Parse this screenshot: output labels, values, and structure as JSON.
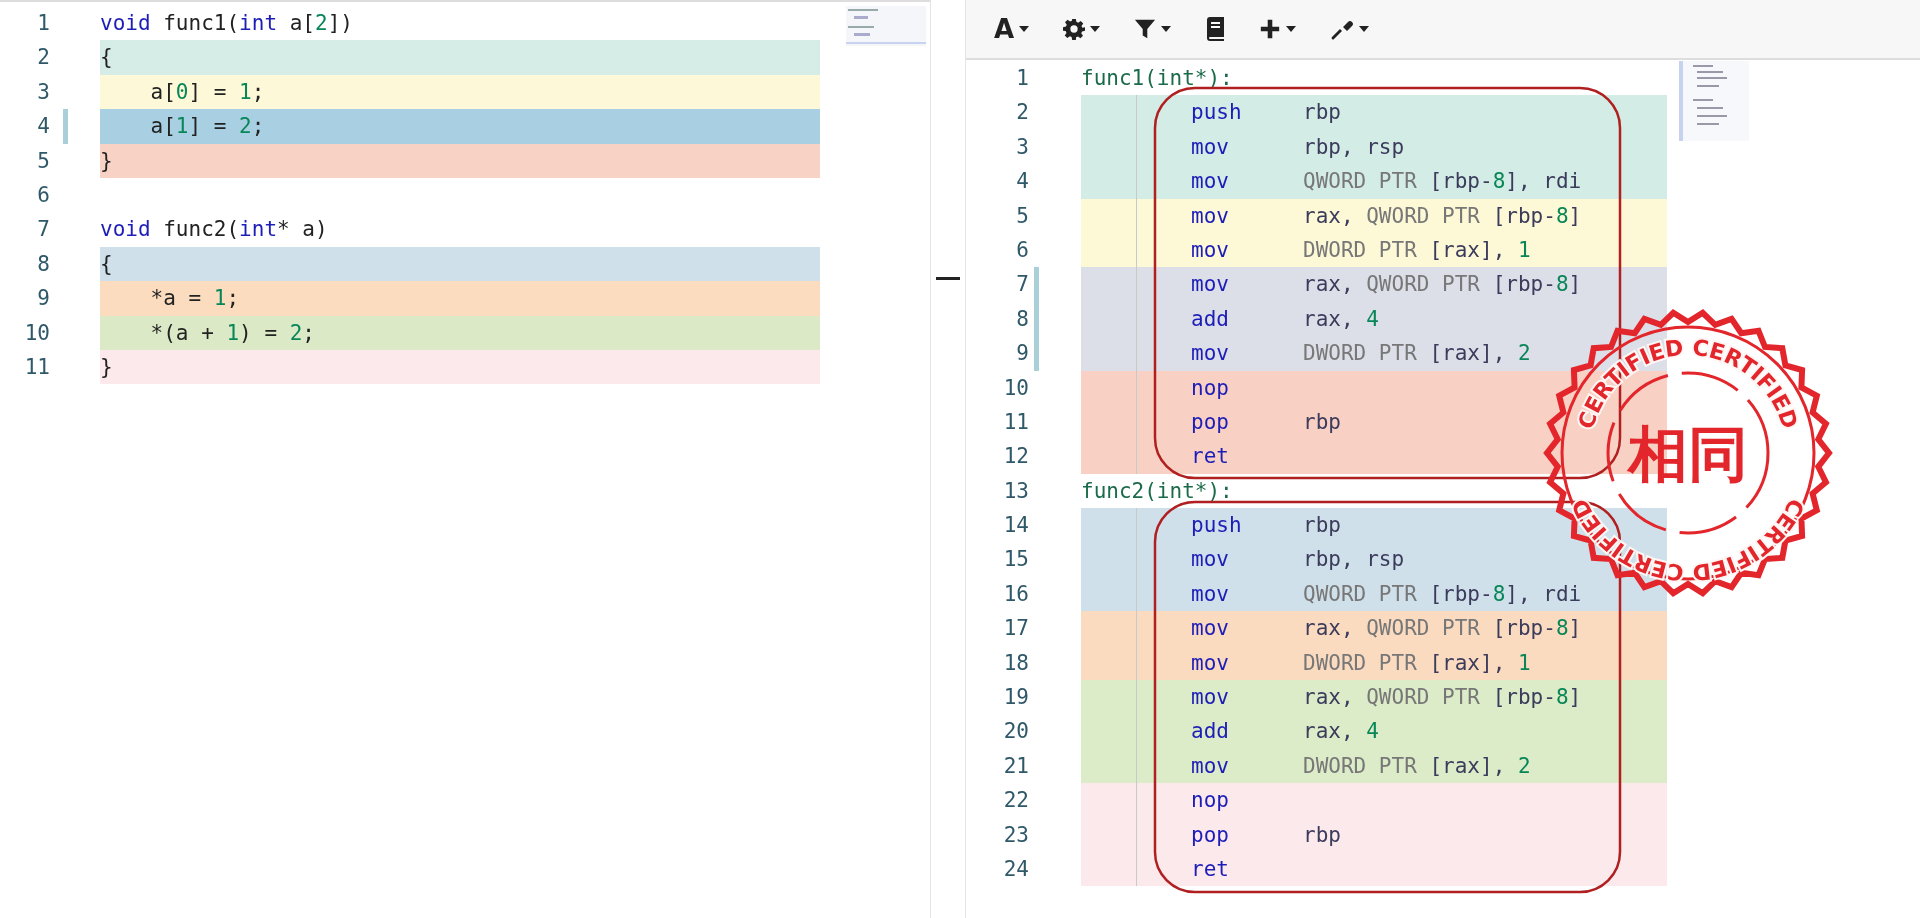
{
  "source_pane": {
    "lines": [
      {
        "number": "1",
        "marked": false,
        "tokens": [
          {
            "kind": "keyword",
            "text": "void"
          },
          {
            "kind": "text",
            "text": " func1("
          },
          {
            "kind": "keyword",
            "text": "int"
          },
          {
            "kind": "text",
            "text": " a["
          },
          {
            "kind": "number",
            "text": "2"
          },
          {
            "kind": "text",
            "text": "])"
          }
        ]
      },
      {
        "number": "2",
        "marked": false,
        "color": "#d6ece6",
        "tokens": [
          {
            "kind": "text",
            "text": "{"
          }
        ]
      },
      {
        "number": "3",
        "marked": false,
        "color": "#fdf8d8",
        "tokens": [
          {
            "kind": "text",
            "text": "    a["
          },
          {
            "kind": "number",
            "text": "0"
          },
          {
            "kind": "text",
            "text": "] = "
          },
          {
            "kind": "number",
            "text": "1"
          },
          {
            "kind": "text",
            "text": ";"
          }
        ]
      },
      {
        "number": "4",
        "marked": true,
        "color": "#a9d0e2",
        "tokens": [
          {
            "kind": "text",
            "text": "    a["
          },
          {
            "kind": "number",
            "text": "1"
          },
          {
            "kind": "text",
            "text": "] = "
          },
          {
            "kind": "number",
            "text": "2"
          },
          {
            "kind": "text",
            "text": ";"
          }
        ]
      },
      {
        "number": "5",
        "marked": false,
        "color": "#f9d2c6",
        "tokens": [
          {
            "kind": "text",
            "text": "}"
          }
        ]
      },
      {
        "number": "6",
        "marked": false
      },
      {
        "number": "7",
        "marked": false,
        "tokens": [
          {
            "kind": "keyword",
            "text": "void"
          },
          {
            "kind": "text",
            "text": " func2("
          },
          {
            "kind": "keyword",
            "text": "int"
          },
          {
            "kind": "text",
            "text": "* a)"
          }
        ]
      },
      {
        "number": "8",
        "marked": false,
        "color": "#cfe0ea",
        "tokens": [
          {
            "kind": "text",
            "text": "{"
          }
        ]
      },
      {
        "number": "9",
        "marked": false,
        "color": "#fbdcbf",
        "tokens": [
          {
            "kind": "text",
            "text": "    *a = "
          },
          {
            "kind": "number",
            "text": "1"
          },
          {
            "kind": "text",
            "text": ";"
          }
        ]
      },
      {
        "number": "10",
        "marked": false,
        "color": "#dbe9c6",
        "tokens": [
          {
            "kind": "text",
            "text": "    *(a + "
          },
          {
            "kind": "number",
            "text": "1"
          },
          {
            "kind": "text",
            "text": ") = "
          },
          {
            "kind": "number",
            "text": "2"
          },
          {
            "kind": "text",
            "text": ";"
          }
        ]
      },
      {
        "number": "11",
        "marked": false,
        "color": "#fbe9ec",
        "tokens": [
          {
            "kind": "text",
            "text": "}"
          }
        ]
      }
    ]
  },
  "assembly_pane": {
    "toolbar": [
      {
        "kind": "font",
        "glyph": "A",
        "dropdown": true
      },
      {
        "kind": "settings",
        "dropdown": true
      },
      {
        "kind": "filter",
        "dropdown": true
      },
      {
        "kind": "libraries",
        "dropdown": false
      },
      {
        "kind": "add",
        "dropdown": true
      },
      {
        "kind": "tools",
        "dropdown": true
      }
    ],
    "lines": [
      {
        "number": "1",
        "kind": "label",
        "marked": false,
        "text": "func1(int*):"
      },
      {
        "number": "2",
        "kind": "instruction",
        "marked": false,
        "color": "#d3ece5",
        "mnemonic": "push",
        "operands": [
          {
            "kind": "register",
            "text": "rbp"
          }
        ]
      },
      {
        "number": "3",
        "kind": "instruction",
        "marked": false,
        "color": "#d3ece5",
        "mnemonic": "mov",
        "operands": [
          {
            "kind": "register",
            "text": "rbp, rsp"
          }
        ]
      },
      {
        "number": "4",
        "kind": "instruction",
        "marked": false,
        "color": "#d3ece5",
        "mnemonic": "mov",
        "operands": [
          {
            "kind": "directive",
            "text": "QWORD PTR "
          },
          {
            "kind": "register",
            "text": "[rbp-"
          },
          {
            "kind": "number",
            "text": "8"
          },
          {
            "kind": "register",
            "text": "], rdi"
          }
        ]
      },
      {
        "number": "5",
        "kind": "instruction",
        "marked": false,
        "color": "#fdf8d6",
        "mnemonic": "mov",
        "operands": [
          {
            "kind": "register",
            "text": "rax, "
          },
          {
            "kind": "directive",
            "text": "QWORD PTR "
          },
          {
            "kind": "register",
            "text": "[rbp-"
          },
          {
            "kind": "number",
            "text": "8"
          },
          {
            "kind": "register",
            "text": "]"
          }
        ]
      },
      {
        "number": "6",
        "kind": "instruction",
        "marked": false,
        "color": "#fdf8d6",
        "mnemonic": "mov",
        "operands": [
          {
            "kind": "directive",
            "text": "DWORD PTR "
          },
          {
            "kind": "register",
            "text": "[rax], "
          },
          {
            "kind": "number",
            "text": "1"
          }
        ]
      },
      {
        "number": "7",
        "kind": "instruction",
        "marked": true,
        "color": "#dcdfe8",
        "mnemonic": "mov",
        "operands": [
          {
            "kind": "register",
            "text": "rax, "
          },
          {
            "kind": "directive",
            "text": "QWORD PTR "
          },
          {
            "kind": "register",
            "text": "[rbp-"
          },
          {
            "kind": "number",
            "text": "8"
          },
          {
            "kind": "register",
            "text": "]"
          }
        ]
      },
      {
        "number": "8",
        "kind": "instruction",
        "marked": true,
        "color": "#dcdfe8",
        "mnemonic": "add",
        "operands": [
          {
            "kind": "register",
            "text": "rax, "
          },
          {
            "kind": "number",
            "text": "4"
          }
        ]
      },
      {
        "number": "9",
        "kind": "instruction",
        "marked": true,
        "color": "#dcdfe8",
        "mnemonic": "mov",
        "operands": [
          {
            "kind": "directive",
            "text": "DWORD PTR "
          },
          {
            "kind": "register",
            "text": "[rax], "
          },
          {
            "kind": "number",
            "text": "2"
          }
        ]
      },
      {
        "number": "10",
        "kind": "instruction",
        "marked": false,
        "color": "#f9d0c4",
        "mnemonic": "nop"
      },
      {
        "number": "11",
        "kind": "instruction",
        "marked": false,
        "color": "#f9d0c4",
        "mnemonic": "pop",
        "operands": [
          {
            "kind": "register",
            "text": "rbp"
          }
        ]
      },
      {
        "number": "12",
        "kind": "instruction",
        "marked": false,
        "color": "#f9d0c4",
        "mnemonic": "ret"
      },
      {
        "number": "13",
        "kind": "label",
        "marked": false,
        "text": "func2(int*):"
      },
      {
        "number": "14",
        "kind": "instruction",
        "marked": false,
        "color": "#cfe0ea",
        "mnemonic": "push",
        "operands": [
          {
            "kind": "register",
            "text": "rbp"
          }
        ]
      },
      {
        "number": "15",
        "kind": "instruction",
        "marked": false,
        "color": "#cfe0ea",
        "mnemonic": "mov",
        "operands": [
          {
            "kind": "register",
            "text": "rbp, rsp"
          }
        ]
      },
      {
        "number": "16",
        "kind": "instruction",
        "marked": false,
        "color": "#cfe0ea",
        "mnemonic": "mov",
        "operands": [
          {
            "kind": "directive",
            "text": "QWORD PTR "
          },
          {
            "kind": "register",
            "text": "[rbp-"
          },
          {
            "kind": "number",
            "text": "8"
          },
          {
            "kind": "register",
            "text": "], rdi"
          }
        ]
      },
      {
        "number": "17",
        "kind": "instruction",
        "marked": false,
        "color": "#fbdbc0",
        "mnemonic": "mov",
        "operands": [
          {
            "kind": "register",
            "text": "rax, "
          },
          {
            "kind": "directive",
            "text": "QWORD PTR "
          },
          {
            "kind": "register",
            "text": "[rbp-"
          },
          {
            "kind": "number",
            "text": "8"
          },
          {
            "kind": "register",
            "text": "]"
          }
        ]
      },
      {
        "number": "18",
        "kind": "instruction",
        "marked": false,
        "color": "#fbdbc0",
        "mnemonic": "mov",
        "operands": [
          {
            "kind": "directive",
            "text": "DWORD PTR "
          },
          {
            "kind": "register",
            "text": "[rax], "
          },
          {
            "kind": "number",
            "text": "1"
          }
        ]
      },
      {
        "number": "19",
        "kind": "instruction",
        "marked": false,
        "color": "#dcebc8",
        "mnemonic": "mov",
        "operands": [
          {
            "kind": "register",
            "text": "rax, "
          },
          {
            "kind": "directive",
            "text": "QWORD PTR "
          },
          {
            "kind": "register",
            "text": "[rbp-"
          },
          {
            "kind": "number",
            "text": "8"
          },
          {
            "kind": "register",
            "text": "]"
          }
        ]
      },
      {
        "number": "20",
        "kind": "instruction",
        "marked": false,
        "color": "#dcebc8",
        "mnemonic": "add",
        "operands": [
          {
            "kind": "register",
            "text": "rax, "
          },
          {
            "kind": "number",
            "text": "4"
          }
        ]
      },
      {
        "number": "21",
        "kind": "instruction",
        "marked": false,
        "color": "#dcebc8",
        "mnemonic": "mov",
        "operands": [
          {
            "kind": "directive",
            "text": "DWORD PTR "
          },
          {
            "kind": "register",
            "text": "[rax], "
          },
          {
            "kind": "number",
            "text": "2"
          }
        ]
      },
      {
        "number": "22",
        "kind": "instruction",
        "marked": false,
        "color": "#fbe9ec",
        "mnemonic": "nop"
      },
      {
        "number": "23",
        "kind": "instruction",
        "marked": false,
        "color": "#fbe9ec",
        "mnemonic": "pop",
        "operands": [
          {
            "kind": "register",
            "text": "rbp"
          }
        ]
      },
      {
        "number": "24",
        "kind": "instruction",
        "marked": false,
        "color": "#fbe9ec",
        "mnemonic": "ret"
      }
    ]
  },
  "stamp": {
    "top_text": "CERTIFIED CERTIFIED",
    "center_text": "相同",
    "bottom_text": "CERTIFIED CERTIFIED"
  }
}
